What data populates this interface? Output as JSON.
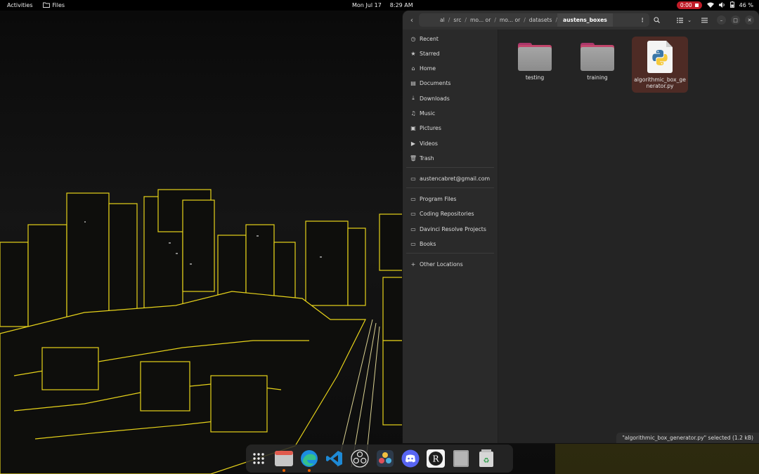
{
  "topbar": {
    "activities": "Activities",
    "app_name": "Files",
    "date": "Mon Jul 17",
    "time": "8:29 AM",
    "recording_time": "0:00",
    "battery": "46 %"
  },
  "window": {
    "path": [
      "al",
      "src",
      "mo... or",
      "mo... or",
      "datasets",
      "austens_boxes"
    ],
    "sidebar": {
      "places": [
        "Recent",
        "Starred",
        "Home",
        "Documents",
        "Downloads",
        "Music",
        "Pictures",
        "Videos",
        "Trash"
      ],
      "account": "austencabret@gmail.com",
      "bookmarks": [
        "Program Files",
        "Coding Repositories",
        "Davinci Resolve Projects",
        "Books"
      ],
      "other": "Other Locations"
    },
    "files": [
      {
        "name": "testing",
        "kind": "folder"
      },
      {
        "name": "training",
        "kind": "folder"
      },
      {
        "name": "algorithmic_box_generator.py",
        "kind": "python",
        "selected": true
      }
    ],
    "status": "\"algorithmic_box_generator.py\" selected  (1.2 kB)"
  },
  "dock": {
    "apps": [
      "show-apps-icon",
      "files-icon",
      "edge-icon",
      "vscode-icon",
      "obs-icon",
      "davinci-icon",
      "discord-icon",
      "rstudio-icon",
      "disk-icon",
      "trash-icon"
    ]
  },
  "colors": {
    "accent_selection": "#4e2b25",
    "recording": "#c01c28",
    "folder_tab": "#c2466b",
    "wallpaper_outline": "#e6d21a"
  }
}
